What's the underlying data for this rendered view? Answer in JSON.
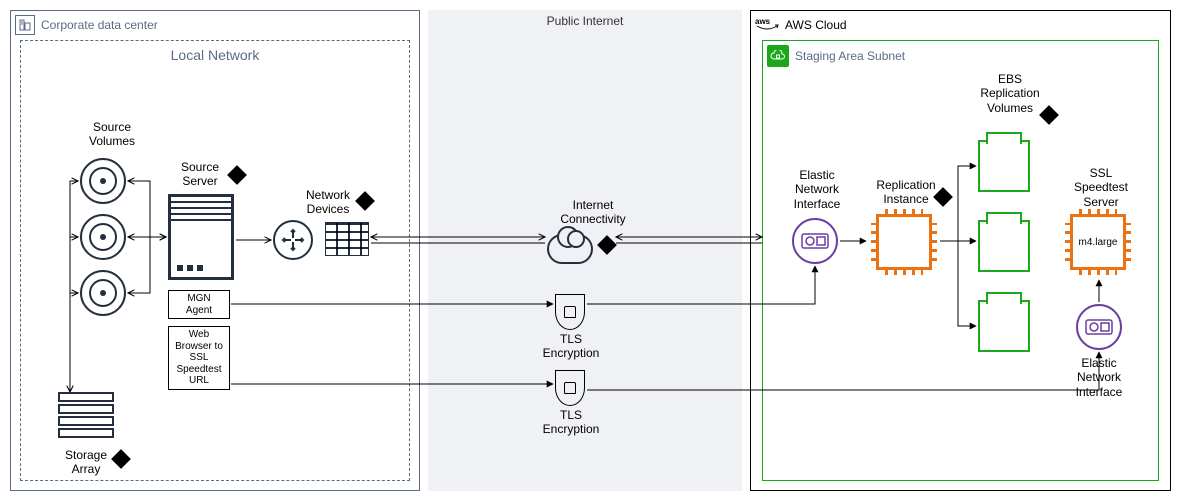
{
  "regions": {
    "corp": "Corporate data center",
    "internet": "Public Internet",
    "aws": "AWS Cloud",
    "subnet": "Staging Area Subnet",
    "localnet": "Local Network"
  },
  "corp": {
    "source_volumes": "Source\nVolumes",
    "source_server": "Source\nServer",
    "network_devices": "Network\nDevices",
    "storage_array": "Storage\nArray",
    "mgn_agent": "MGN\nAgent",
    "browser_box": "Web\nBrowser to\nSSL\nSpeedtest\nURL"
  },
  "internet": {
    "connectivity": "Internet\nConnectivity",
    "tls1": "TLS\nEncryption",
    "tls2": "TLS\nEncryption"
  },
  "aws_labels": {
    "eni1": "Elastic\nNetwork\nInterface",
    "replication_instance": "Replication\nInstance",
    "ebs_volumes": "EBS\nReplication\nVolumes",
    "ssl_server": "SSL\nSpeedtest\nServer",
    "instance_type": "m4.large",
    "eni2": "Elastic\nNetwork\nInterface"
  },
  "chart_data": {
    "type": "diagram",
    "nodes": [
      {
        "id": "source_volumes",
        "label": "Source Volumes",
        "zone": "Corporate data center/Local Network"
      },
      {
        "id": "source_server",
        "label": "Source Server",
        "zone": "Corporate data center/Local Network",
        "callout": true
      },
      {
        "id": "mgn_agent",
        "label": "MGN Agent",
        "zone": "Corporate data center/Local Network"
      },
      {
        "id": "browser",
        "label": "Web Browser to SSL Speedtest URL",
        "zone": "Corporate data center/Local Network"
      },
      {
        "id": "network_devices",
        "label": "Network Devices",
        "zone": "Corporate data center/Local Network",
        "callout": true
      },
      {
        "id": "storage_array",
        "label": "Storage Array",
        "zone": "Corporate data center/Local Network",
        "callout": true
      },
      {
        "id": "internet",
        "label": "Internet Connectivity",
        "zone": "Public Internet",
        "callout": true
      },
      {
        "id": "tls1",
        "label": "TLS Encryption",
        "zone": "Public Internet"
      },
      {
        "id": "tls2",
        "label": "TLS Encryption",
        "zone": "Public Internet"
      },
      {
        "id": "eni1",
        "label": "Elastic Network Interface",
        "zone": "AWS Cloud/Staging Area Subnet"
      },
      {
        "id": "replication_instance",
        "label": "Replication Instance",
        "zone": "AWS Cloud/Staging Area Subnet",
        "callout": true
      },
      {
        "id": "ebs",
        "label": "EBS Replication Volumes",
        "zone": "AWS Cloud/Staging Area Subnet",
        "count": 3,
        "callout": true
      },
      {
        "id": "eni2",
        "label": "Elastic Network Interface",
        "zone": "AWS Cloud/Staging Area Subnet"
      },
      {
        "id": "ssl_server",
        "label": "SSL Speedtest Server",
        "instance_type": "m4.large",
        "zone": "AWS Cloud/Staging Area Subnet"
      }
    ],
    "edges": [
      {
        "from": "storage_array",
        "to": "source_volumes",
        "style": "bidirectional"
      },
      {
        "from": "source_volumes",
        "to": "source_server",
        "style": "bidirectional"
      },
      {
        "from": "source_server",
        "to": "network_devices"
      },
      {
        "from": "network_devices",
        "to": "internet",
        "style": "double-line-bidirectional"
      },
      {
        "from": "internet",
        "to": "eni1",
        "style": "double-line-bidirectional"
      },
      {
        "from": "mgn_agent",
        "to": "tls1"
      },
      {
        "from": "tls1",
        "to": "eni1"
      },
      {
        "from": "browser",
        "to": "tls2"
      },
      {
        "from": "tls2",
        "to": "eni2"
      },
      {
        "from": "eni1",
        "to": "replication_instance"
      },
      {
        "from": "replication_instance",
        "to": "ebs"
      },
      {
        "from": "eni2",
        "to": "ssl_server"
      }
    ],
    "zones": [
      "Corporate data center",
      "Local Network",
      "Public Internet",
      "AWS Cloud",
      "Staging Area Subnet"
    ]
  }
}
